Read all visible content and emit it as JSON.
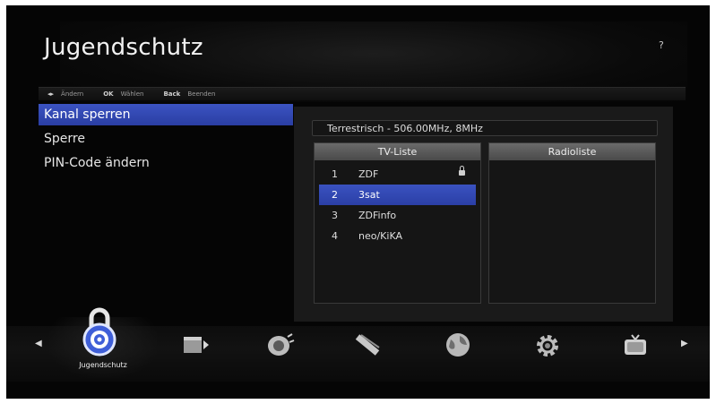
{
  "header": {
    "title": "Jugendschutz",
    "help": "?"
  },
  "hints": [
    {
      "key": "◂▸",
      "label": "Ändern"
    },
    {
      "key": "OK",
      "label": "Wählen"
    },
    {
      "key": "Back",
      "label": "Beenden"
    }
  ],
  "menu": {
    "items": [
      {
        "label": "Kanal sperren",
        "selected": true
      },
      {
        "label": "Sperre",
        "selected": false
      },
      {
        "label": "PIN-Code ändern",
        "selected": false
      }
    ]
  },
  "channel_panel": {
    "frequency": "Terrestrisch - 506.00MHz, 8MHz",
    "tv_header": "TV-Liste",
    "radio_header": "Radioliste",
    "tv_rows": [
      {
        "num": "1",
        "name": "ZDF",
        "locked": true
      },
      {
        "num": "2",
        "name": "3sat",
        "selected": true
      },
      {
        "num": "3",
        "name": "ZDFinfo"
      },
      {
        "num": "4",
        "name": "neo/KiKA"
      }
    ]
  },
  "bottom_bar": {
    "active_label": "Jugendschutz",
    "icons": [
      "lock-icon",
      "media-icon",
      "satellite-dish-icon",
      "antenna-icon",
      "globe-icon",
      "settings-gear-icon",
      "tv-icon"
    ],
    "colors": {
      "active_accent": "#3f5fd8",
      "selection": "#2f45b0"
    }
  }
}
